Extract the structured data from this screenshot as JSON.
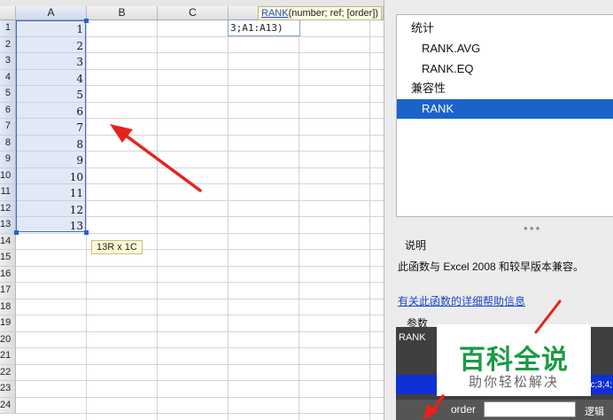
{
  "sheet": {
    "columns": [
      "A",
      "B",
      "C"
    ],
    "rows": [
      "1",
      "2",
      "3",
      "4",
      "5",
      "6",
      "7",
      "8",
      "9",
      "10",
      "11",
      "12",
      "13",
      "14",
      "15",
      "16",
      "17",
      "18",
      "19",
      "20",
      "21",
      "22",
      "23",
      "24"
    ],
    "cell_values": [
      "1",
      "2",
      "3",
      "4",
      "5",
      "6",
      "7",
      "8",
      "9",
      "10",
      "11",
      "12",
      "13"
    ],
    "selection_size": "13R x 1C",
    "edit_text": "3;A1:A13)",
    "tooltip": {
      "fn": "RANK",
      "args": "(number; ref; [order])"
    }
  },
  "panel": {
    "list": [
      {
        "label": "统计",
        "kind": "cat"
      },
      {
        "label": "RANK.AVG",
        "kind": "fn"
      },
      {
        "label": "RANK.EQ",
        "kind": "fn"
      },
      {
        "label": "兼容性",
        "kind": "cat"
      },
      {
        "label": "RANK",
        "kind": "fn",
        "active": true
      }
    ],
    "desc_title": "说明",
    "desc_text": "此函数与 Excel 2008 和较早版本兼容。",
    "help_link": "有关此函数的详细帮助信息",
    "params_title": "参数",
    "fnbox": {
      "name": "RANK",
      "value_tail": "c;3;4;",
      "order_label": "order",
      "logic_label": "逻辑"
    }
  },
  "watermark": {
    "main": "百科全说",
    "sub": "助你轻松解决"
  },
  "colors": {
    "accent": "#1a63c9",
    "arrow": "#e8211b",
    "watermark": "#1a9a45"
  }
}
